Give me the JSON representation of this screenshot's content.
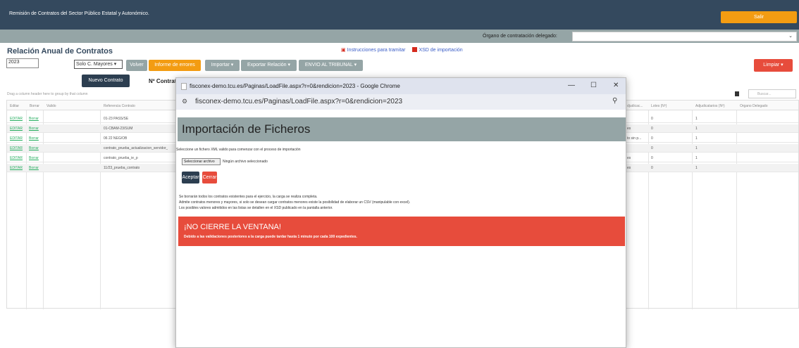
{
  "topbar": {
    "title": "Remisión de Contratos del Sector Público Estatal y Autonómico.",
    "exit_label": "Salir"
  },
  "organ": {
    "label": "Órgano de contratación delegado:",
    "value": ""
  },
  "page": {
    "title": "Relación Anual de Contratos"
  },
  "links": {
    "instructions": "Instrucciones para tramitar",
    "xsd": "XSD de importación"
  },
  "filters": {
    "year": "2023",
    "type_selected": "Solo C. Mayores"
  },
  "buttons": {
    "volver": "Volver",
    "informe": "Informe de errores",
    "importar": "Importar ▾",
    "exportar": "Exportar Relación ▾",
    "envio": "ENVIO AL TRIBUNAL ▾",
    "limpiar": "Limpiar ▾",
    "nuevo": "Nuevo Contrato"
  },
  "ncontrato": "Nº Contrat",
  "grid": {
    "drag_hint": "Drag a column header here to group by that column",
    "search_placeholder": "Buscar...",
    "headers": {
      "editar": "Editar",
      "borrar": "Borrar",
      "valido": "Valido",
      "referencia": "Referencia Contrato",
      "adjudicacion": "djudicac...",
      "lotes": "Lotes (Nº)",
      "adjudicatarios": "Adjudicatarios (Nº)",
      "organo": "Organo Delegado"
    },
    "rows": [
      {
        "editar": "EDITAR",
        "borrar": "Borrar",
        "referencia": "01-23 PASS/SE",
        "adj": "",
        "lotes": "0",
        "adjudicatarios": "1"
      },
      {
        "editar": "EDITAR",
        "borrar": "Borrar",
        "referencia": "01-CBAM-23/SUM",
        "adj": "es",
        "lotes": "0",
        "adjudicatarios": "1"
      },
      {
        "editar": "EDITAR",
        "borrar": "Borrar",
        "referencia": "06 22 NEG/OB",
        "adj": "to sin p...",
        "lotes": "0",
        "adjudicatarios": "1"
      },
      {
        "editar": "EDITAR",
        "borrar": "Borrar",
        "referencia": "contrato_prueba_actualizacion_servidor_",
        "adj": "",
        "lotes": "0",
        "adjudicatarios": "1"
      },
      {
        "editar": "EDITAR",
        "borrar": "Borrar",
        "referencia": "contrato_prueba_ie_p",
        "adj": "es",
        "lotes": "0",
        "adjudicatarios": "1"
      },
      {
        "editar": "EDITAR",
        "borrar": "Borrar",
        "referencia": "11/23_prueba_contrato",
        "adj": "es",
        "lotes": "0",
        "adjudicatarios": "1"
      }
    ]
  },
  "popup": {
    "window_title": "fisconex-demo.tcu.es/Paginas/LoadFile.aspx?r=0&rendicion=2023 - Google Chrome",
    "url": "fisconex-demo.tcu.es/Paginas/LoadFile.aspx?r=0&rendicion=2023",
    "heading": "Importación de Ficheros",
    "select_text": "Seleccione un fichero XML valido para comenzar con el proceso de importación",
    "file_button": "Seleccionar archivo",
    "no_file": "Ningún archivo seleccionado",
    "accept": "Aceptar",
    "close": "Cerrar",
    "info_lines": [
      "Se borrarán todos los contratos existentes para el ejercicio, la carga se realiza completa.",
      "Admite contratos menores y mayores, si solo se desean cargar contratos menores existe la posibilidad de elaborar un CSV (manipulable con excel).",
      "Los posibles valores admitidos en las listas se detallen en el XSD publicado en la pantalla anterior."
    ],
    "warning_title": "¡NO CIERRE LA VENTANA!",
    "warning_sub": "Debido a las validaciones posteriores a la carga puede tardar hasta 1 minuto por cada 100 expedientes."
  }
}
